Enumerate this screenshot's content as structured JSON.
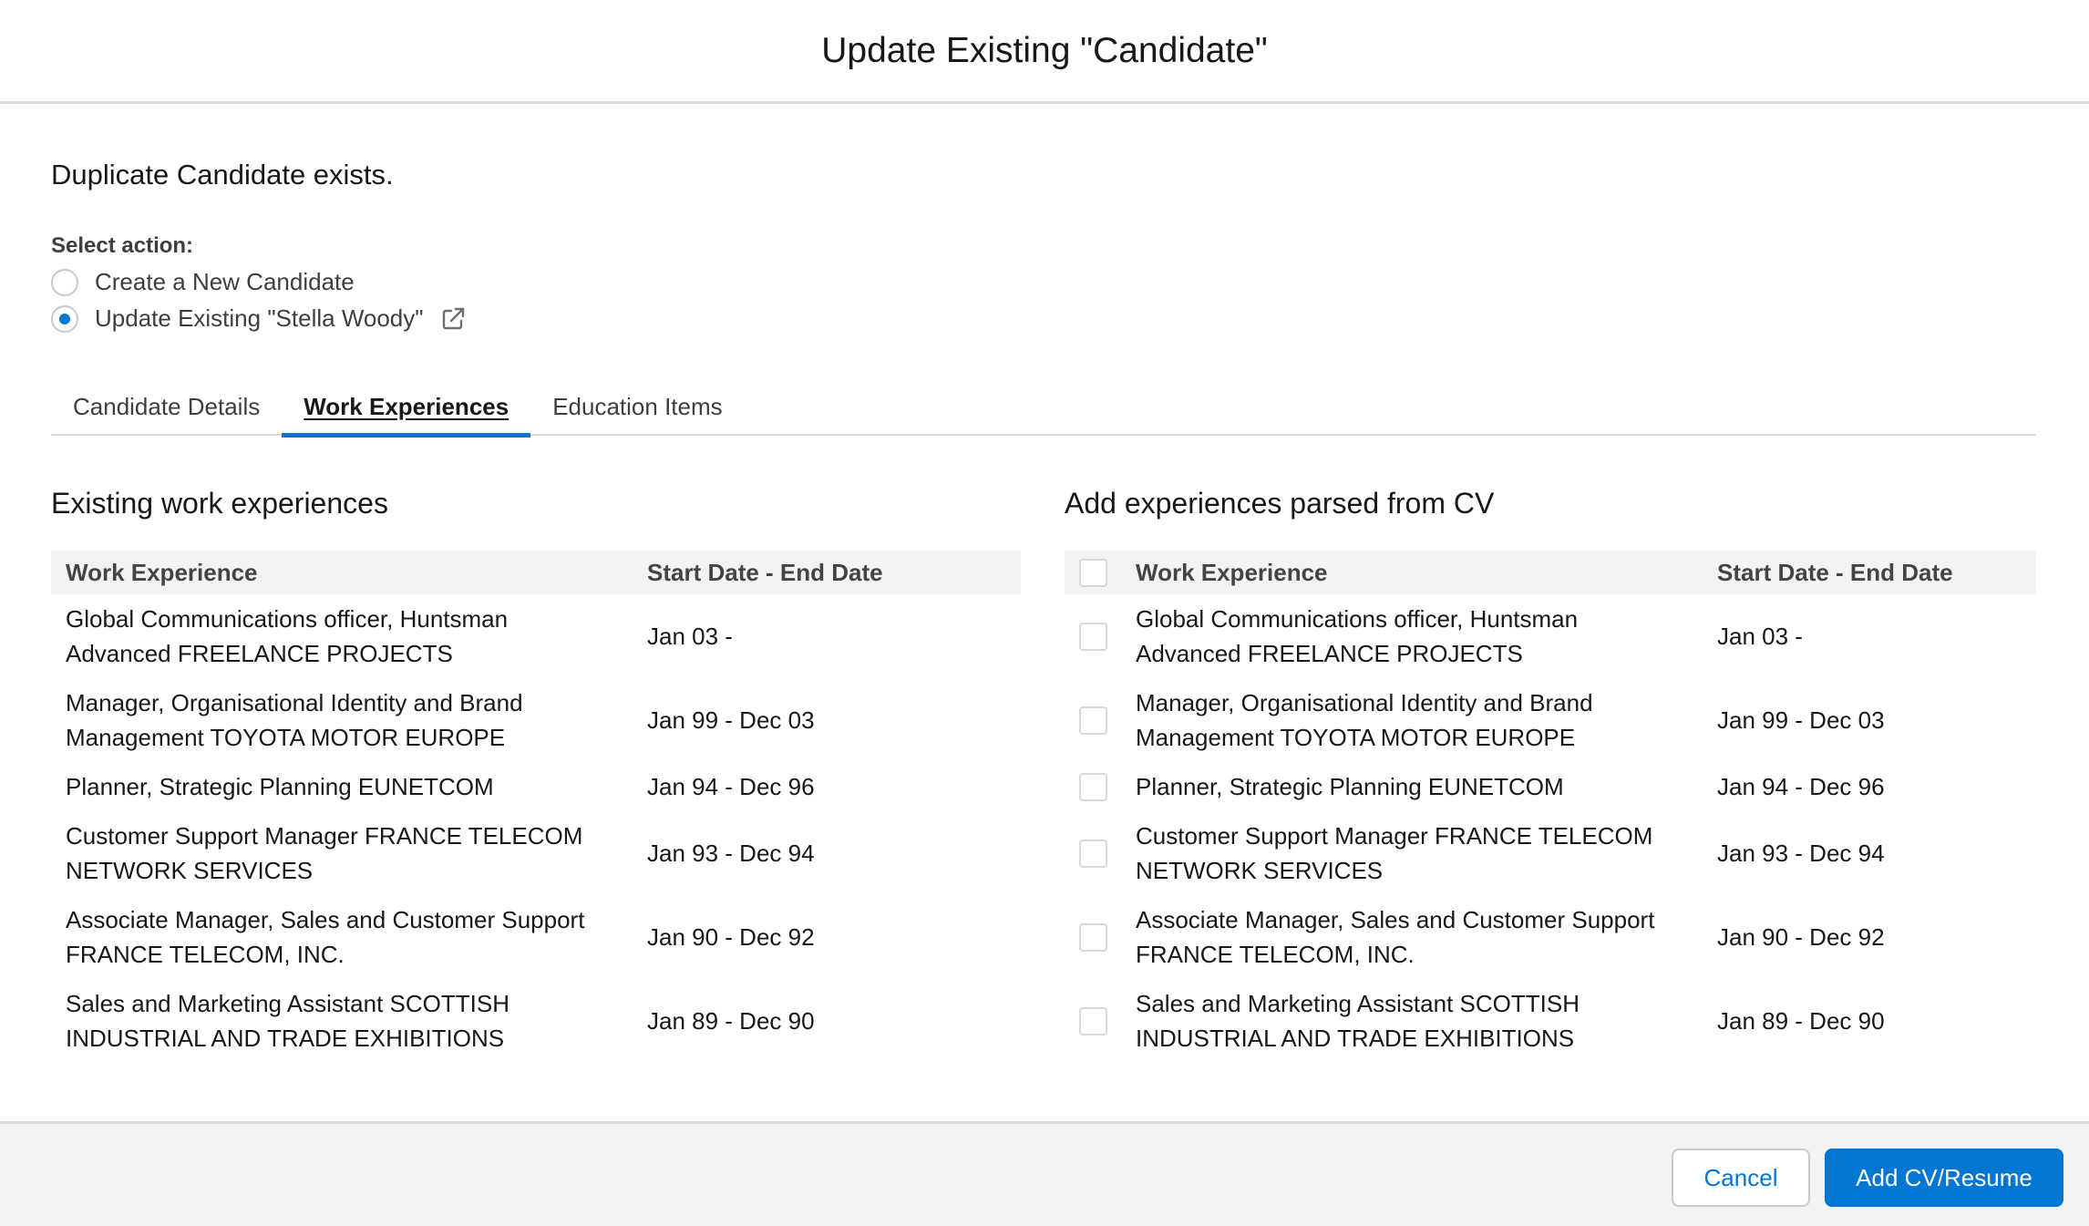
{
  "modal": {
    "title": "Update Existing \"Candidate\"",
    "duplicate_text": "Duplicate Candidate exists.",
    "select_action_label": "Select action:",
    "options": [
      {
        "label": "Create a New Candidate",
        "checked": false
      },
      {
        "label": "Update Existing \"Stella Woody\"",
        "checked": true,
        "icon": "external-link-icon"
      }
    ],
    "tabs": [
      {
        "label": "Candidate Details",
        "active": false
      },
      {
        "label": "Work Experiences",
        "active": true
      },
      {
        "label": "Education Items",
        "active": false
      }
    ]
  },
  "existing": {
    "title": "Existing work experiences",
    "headers": {
      "experience": "Work Experience",
      "dates": "Start Date - End Date"
    },
    "rows": [
      {
        "experience": "Global Communications officer, Huntsman Advanced FREELANCE PROJECTS",
        "dates": "Jan 03 -"
      },
      {
        "experience": "Manager, Organisational Identity and Brand Management TOYOTA MOTOR EUROPE",
        "dates": "Jan 99 - Dec 03"
      },
      {
        "experience": "Planner, Strategic Planning EUNETCOM",
        "dates": "Jan 94 - Dec 96"
      },
      {
        "experience": "Customer Support Manager FRANCE TELECOM NETWORK SERVICES",
        "dates": "Jan 93 - Dec 94"
      },
      {
        "experience": "Associate Manager, Sales and Customer Support FRANCE TELECOM, INC.",
        "dates": "Jan 90 - Dec 92"
      },
      {
        "experience": "Sales and Marketing Assistant SCOTTISH INDUSTRIAL AND TRADE EXHIBITIONS",
        "dates": "Jan 89 - Dec 90"
      }
    ]
  },
  "parsed": {
    "title": "Add experiences parsed from CV",
    "headers": {
      "experience": "Work Experience",
      "dates": "Start Date - End Date"
    },
    "rows": [
      {
        "experience": "Global Communications officer, Huntsman Advanced FREELANCE PROJECTS",
        "dates": "Jan 03 -",
        "checked": false
      },
      {
        "experience": "Manager, Organisational Identity and Brand Management TOYOTA MOTOR EUROPE",
        "dates": "Jan 99 - Dec 03",
        "checked": false
      },
      {
        "experience": "Planner, Strategic Planning EUNETCOM",
        "dates": "Jan 94 - Dec 96",
        "checked": false
      },
      {
        "experience": "Customer Support Manager FRANCE TELECOM NETWORK SERVICES",
        "dates": "Jan 93 - Dec 94",
        "checked": false
      },
      {
        "experience": "Associate Manager, Sales and Customer Support FRANCE TELECOM, INC.",
        "dates": "Jan 90 - Dec 92",
        "checked": false
      },
      {
        "experience": "Sales and Marketing Assistant SCOTTISH INDUSTRIAL AND TRADE EXHIBITIONS",
        "dates": "Jan 89 - Dec 90",
        "checked": false
      }
    ]
  },
  "footer": {
    "cancel_label": "Cancel",
    "add_label": "Add CV/Resume"
  },
  "colors": {
    "accent": "#0176d3",
    "border": "#dddbda",
    "header_bg": "#f3f3f3"
  }
}
